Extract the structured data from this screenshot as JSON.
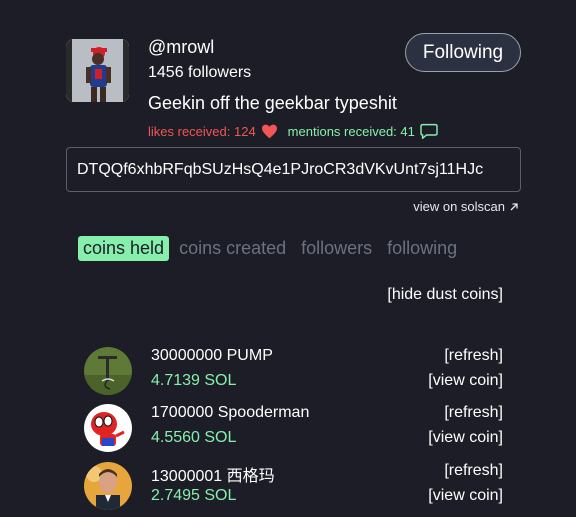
{
  "profile": {
    "username": "@mrowl",
    "followers": "1456 followers",
    "bio": "Geekin off the geekbar typeshit",
    "likes": "likes received: 124",
    "mentions": "mentions received: 41",
    "address": "DTQQf6xhbRFqbSUzHsQ4e1PJroCR3dVKvUnt7sj11HJc",
    "solscan": "view on solscan"
  },
  "follow_button": "Following",
  "tabs": [
    "coins held",
    "coins created",
    "followers",
    "following"
  ],
  "active_tab": "coins held",
  "hide_dust": "[hide dust coins]",
  "coins": [
    {
      "name": "30000000 PUMP",
      "sol": "4.7139 SOL",
      "refresh": "[refresh]",
      "view": "[view coin]"
    },
    {
      "name": "1700000 Spooderman",
      "sol": "4.5560 SOL",
      "refresh": "[refresh]",
      "view": "[view coin]"
    },
    {
      "name": "13000001 西格玛",
      "sol": "2.7495 SOL",
      "refresh": "[refresh]",
      "view": "[view coin]"
    }
  ],
  "colors": {
    "background": "#1c1d26",
    "accent_green": "#86efac",
    "likes_red": "#f25555",
    "muted_tab": "#6b7280"
  }
}
